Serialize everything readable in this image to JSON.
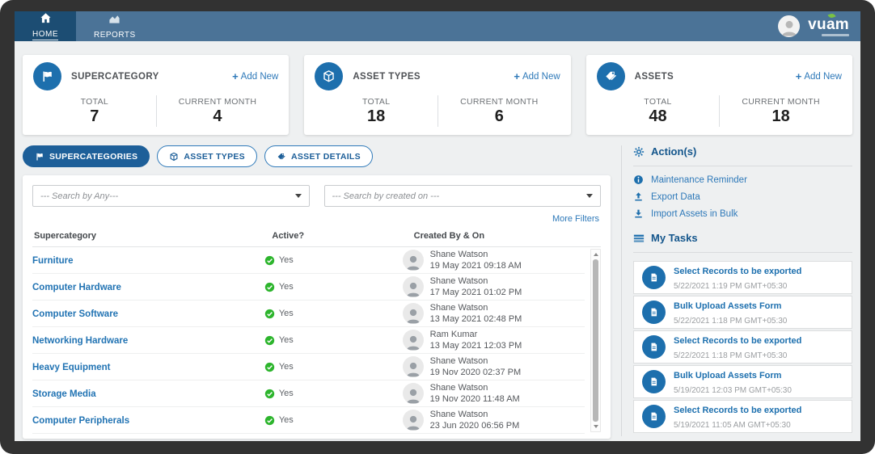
{
  "colors": {
    "navbar": "#4b7397",
    "active_tab": "#1c4d73",
    "accent_blue": "#1d6fad",
    "link_blue": "#2e79b9",
    "header_blue": "#14568c",
    "active_green": "#2db52d",
    "body_bg": "#eef0f1",
    "frame": "#323232"
  },
  "nav": {
    "tabs": [
      {
        "label": "HOME"
      },
      {
        "label": "REPORTS"
      }
    ],
    "logo": {
      "vu": "vu",
      "am": "am"
    }
  },
  "cards": [
    {
      "title": "SUPERCATEGORY",
      "add_new": "Add New",
      "total_label": "TOTAL",
      "total": "7",
      "month_label": "CURRENT MONTH",
      "month": "4"
    },
    {
      "title": "ASSET TYPES",
      "add_new": "Add New",
      "total_label": "TOTAL",
      "total": "18",
      "month_label": "CURRENT MONTH",
      "month": "6"
    },
    {
      "title": "ASSETS",
      "add_new": "Add New",
      "total_label": "TOTAL",
      "total": "48",
      "month_label": "CURRENT MONTH",
      "month": "18"
    }
  ],
  "filter_tabs": [
    {
      "label": "SUPERCATEGORIES",
      "active": true
    },
    {
      "label": "ASSET TYPES",
      "active": false
    },
    {
      "label": "ASSET DETAILS",
      "active": false
    }
  ],
  "filters": {
    "search_any": "--- Search by Any---",
    "search_created": "--- Search by created on ---",
    "more_filters": "More Filters"
  },
  "table": {
    "columns": [
      "Supercategory",
      "Active?",
      "Created By & On"
    ],
    "rows": [
      {
        "name": "Furniture",
        "active": "Yes",
        "by": "Shane Watson",
        "on": "19 May 2021 09:18 AM"
      },
      {
        "name": "Computer Hardware",
        "active": "Yes",
        "by": "Shane Watson",
        "on": "17 May 2021 01:02 PM"
      },
      {
        "name": "Computer Software",
        "active": "Yes",
        "by": "Shane Watson",
        "on": "13 May 2021 02:48 PM"
      },
      {
        "name": "Networking Hardware",
        "active": "Yes",
        "by": "Ram Kumar",
        "on": "13 May 2021 12:03 PM"
      },
      {
        "name": "Heavy Equipment",
        "active": "Yes",
        "by": "Shane Watson",
        "on": "19 Nov 2020 02:37 PM"
      },
      {
        "name": "Storage Media",
        "active": "Yes",
        "by": "Shane Watson",
        "on": "19 Nov 2020 11:48 AM"
      },
      {
        "name": "Computer Peripherals",
        "active": "Yes",
        "by": "Shane Watson",
        "on": "23 Jun 2020 06:56 PM"
      }
    ]
  },
  "actions": {
    "title": "Action(s)",
    "items": [
      {
        "label": "Maintenance Reminder"
      },
      {
        "label": "Export Data"
      },
      {
        "label": "Import Assets in Bulk"
      }
    ]
  },
  "tasks": {
    "title": "My Tasks",
    "items": [
      {
        "title": "Select Records to be exported",
        "time": "5/22/2021 1:19 PM GMT+05:30"
      },
      {
        "title": "Bulk Upload Assets Form",
        "time": "5/22/2021 1:18 PM GMT+05:30"
      },
      {
        "title": "Select Records to be exported",
        "time": "5/22/2021 1:18 PM GMT+05:30"
      },
      {
        "title": "Bulk Upload Assets Form",
        "time": "5/19/2021 12:03 PM GMT+05:30"
      },
      {
        "title": "Select Records to be exported",
        "time": "5/19/2021 11:05 AM GMT+05:30"
      }
    ]
  }
}
